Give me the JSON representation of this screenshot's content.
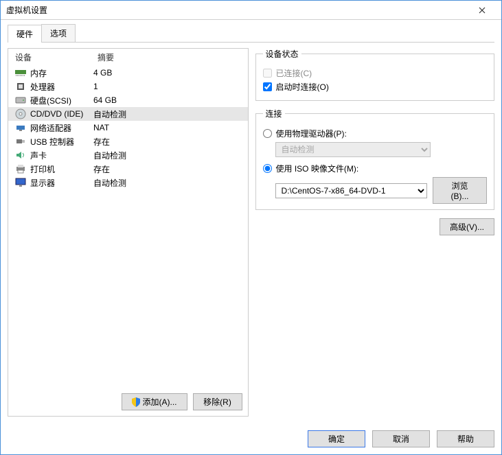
{
  "window": {
    "title": "虚拟机设置"
  },
  "tabs": {
    "hardware": "硬件",
    "options": "选项"
  },
  "headers": {
    "device": "设备",
    "summary": "摘要"
  },
  "devices": [
    {
      "name": "内存",
      "summary": "4 GB",
      "icon": "memory"
    },
    {
      "name": "处理器",
      "summary": "1",
      "icon": "cpu"
    },
    {
      "name": "硬盘(SCSI)",
      "summary": "64 GB",
      "icon": "disk"
    },
    {
      "name": "CD/DVD (IDE)",
      "summary": "自动检测",
      "icon": "cd",
      "selected": true
    },
    {
      "name": "网络适配器",
      "summary": "NAT",
      "icon": "net"
    },
    {
      "name": "USB 控制器",
      "summary": "存在",
      "icon": "usb"
    },
    {
      "name": "声卡",
      "summary": "自动检测",
      "icon": "sound"
    },
    {
      "name": "打印机",
      "summary": "存在",
      "icon": "printer"
    },
    {
      "name": "显示器",
      "summary": "自动检测",
      "icon": "display"
    }
  ],
  "buttons": {
    "add": "添加(A)...",
    "remove": "移除(R)",
    "browse": "浏览(B)...",
    "advanced": "高级(V)...",
    "ok": "确定",
    "cancel": "取消",
    "help": "帮助"
  },
  "status": {
    "legend": "设备状态",
    "connected": {
      "label": "已连接(C)",
      "checked": false,
      "enabled": false
    },
    "connectAtPowerOn": {
      "label": "启动时连接(O)",
      "checked": true
    }
  },
  "connection": {
    "legend": "连接",
    "physical": {
      "label": "使用物理驱动器(P):",
      "selected": false,
      "option": "自动检测"
    },
    "iso": {
      "label": "使用 ISO 映像文件(M):",
      "selected": true,
      "path": "D:\\CentOS-7-x86_64-DVD-1"
    }
  }
}
